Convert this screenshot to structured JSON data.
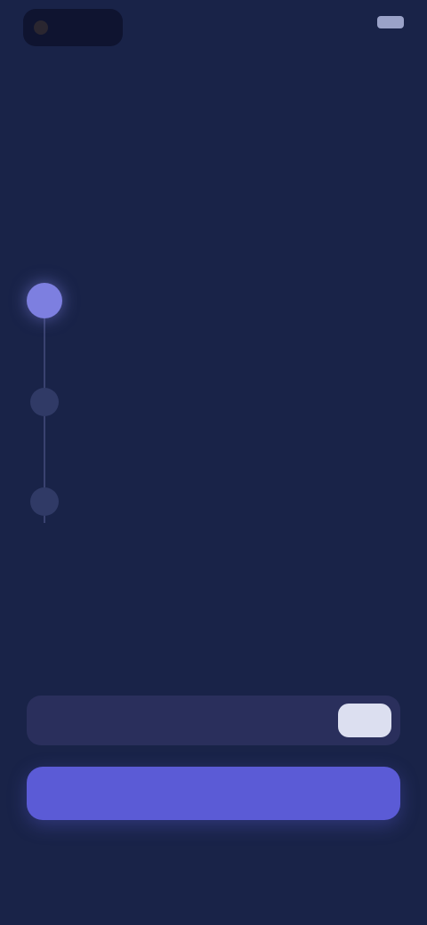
{
  "status_bar": {
    "brand": "",
    "time": ""
  },
  "header": {
    "title": "",
    "subtitle": ""
  },
  "steps": [
    {
      "number": "",
      "title": "",
      "description": "",
      "state": "active"
    },
    {
      "number": "",
      "title": "",
      "description": "",
      "state": "pending"
    },
    {
      "number": "",
      "title": "",
      "description": "",
      "state": "pending"
    }
  ],
  "code_section": {
    "label": "",
    "hint": "",
    "input_value": "",
    "input_placeholder": "",
    "paste_label": ""
  },
  "actions": {
    "primary_label": "",
    "secondary_label": ""
  },
  "colors": {
    "background": "#192348",
    "accent": "#5b5bd6",
    "step_active": "#7d7fe0",
    "step_pending": "#303a66",
    "input_bg": "#2a2f5c"
  }
}
